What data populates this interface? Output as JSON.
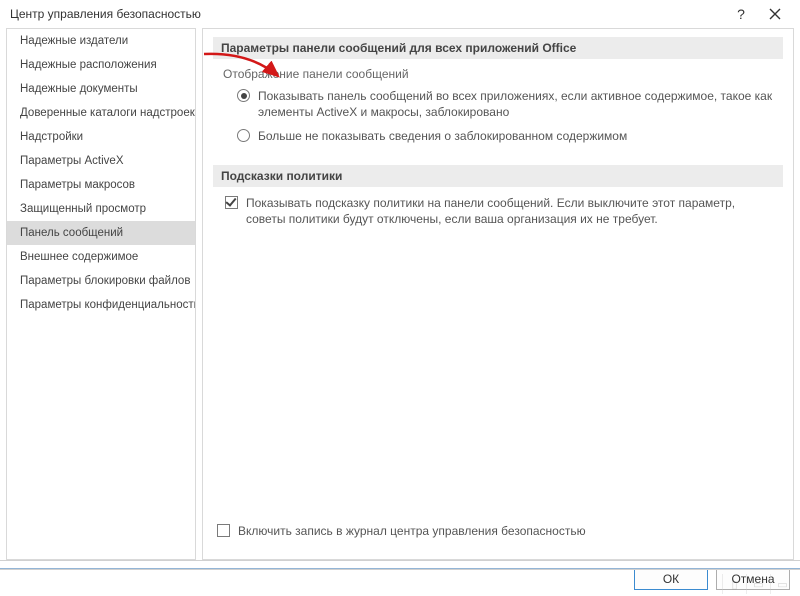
{
  "window": {
    "title": "Центр управления безопасностью"
  },
  "sidebar": {
    "items": [
      {
        "label": "Надежные издатели",
        "selected": false
      },
      {
        "label": "Надежные расположения",
        "selected": false
      },
      {
        "label": "Надежные документы",
        "selected": false
      },
      {
        "label": "Доверенные каталоги надстроек",
        "selected": false
      },
      {
        "label": "Надстройки",
        "selected": false
      },
      {
        "label": "Параметры ActiveX",
        "selected": false
      },
      {
        "label": "Параметры макросов",
        "selected": false
      },
      {
        "label": "Защищенный просмотр",
        "selected": false
      },
      {
        "label": "Панель сообщений",
        "selected": true
      },
      {
        "label": "Внешнее содержимое",
        "selected": false
      },
      {
        "label": "Параметры блокировки файлов",
        "selected": false
      },
      {
        "label": "Параметры конфиденциальности",
        "selected": false
      }
    ]
  },
  "content": {
    "section1": {
      "header": "Параметры панели сообщений для всех приложений Office",
      "subheading": "Отображение панели сообщений",
      "radio_show": "Показывать панель сообщений во всех приложениях, если активное содержимое, такое как элементы ActiveX и макросы, заблокировано",
      "radio_hide": "Больше не показывать сведения о заблокированном содержимом",
      "radio_selected": "show"
    },
    "section2": {
      "header": "Подсказки политики",
      "check_policy": "Показывать подсказку политики на панели сообщений. Если выключите этот параметр, советы политики будут отключены, если ваша организация их не требует.",
      "check_policy_checked": true
    },
    "log_check": {
      "label": "Включить запись в журнал центра управления безопасностью",
      "checked": false
    }
  },
  "footer": {
    "ok": "ОК",
    "cancel": "Отмена"
  }
}
